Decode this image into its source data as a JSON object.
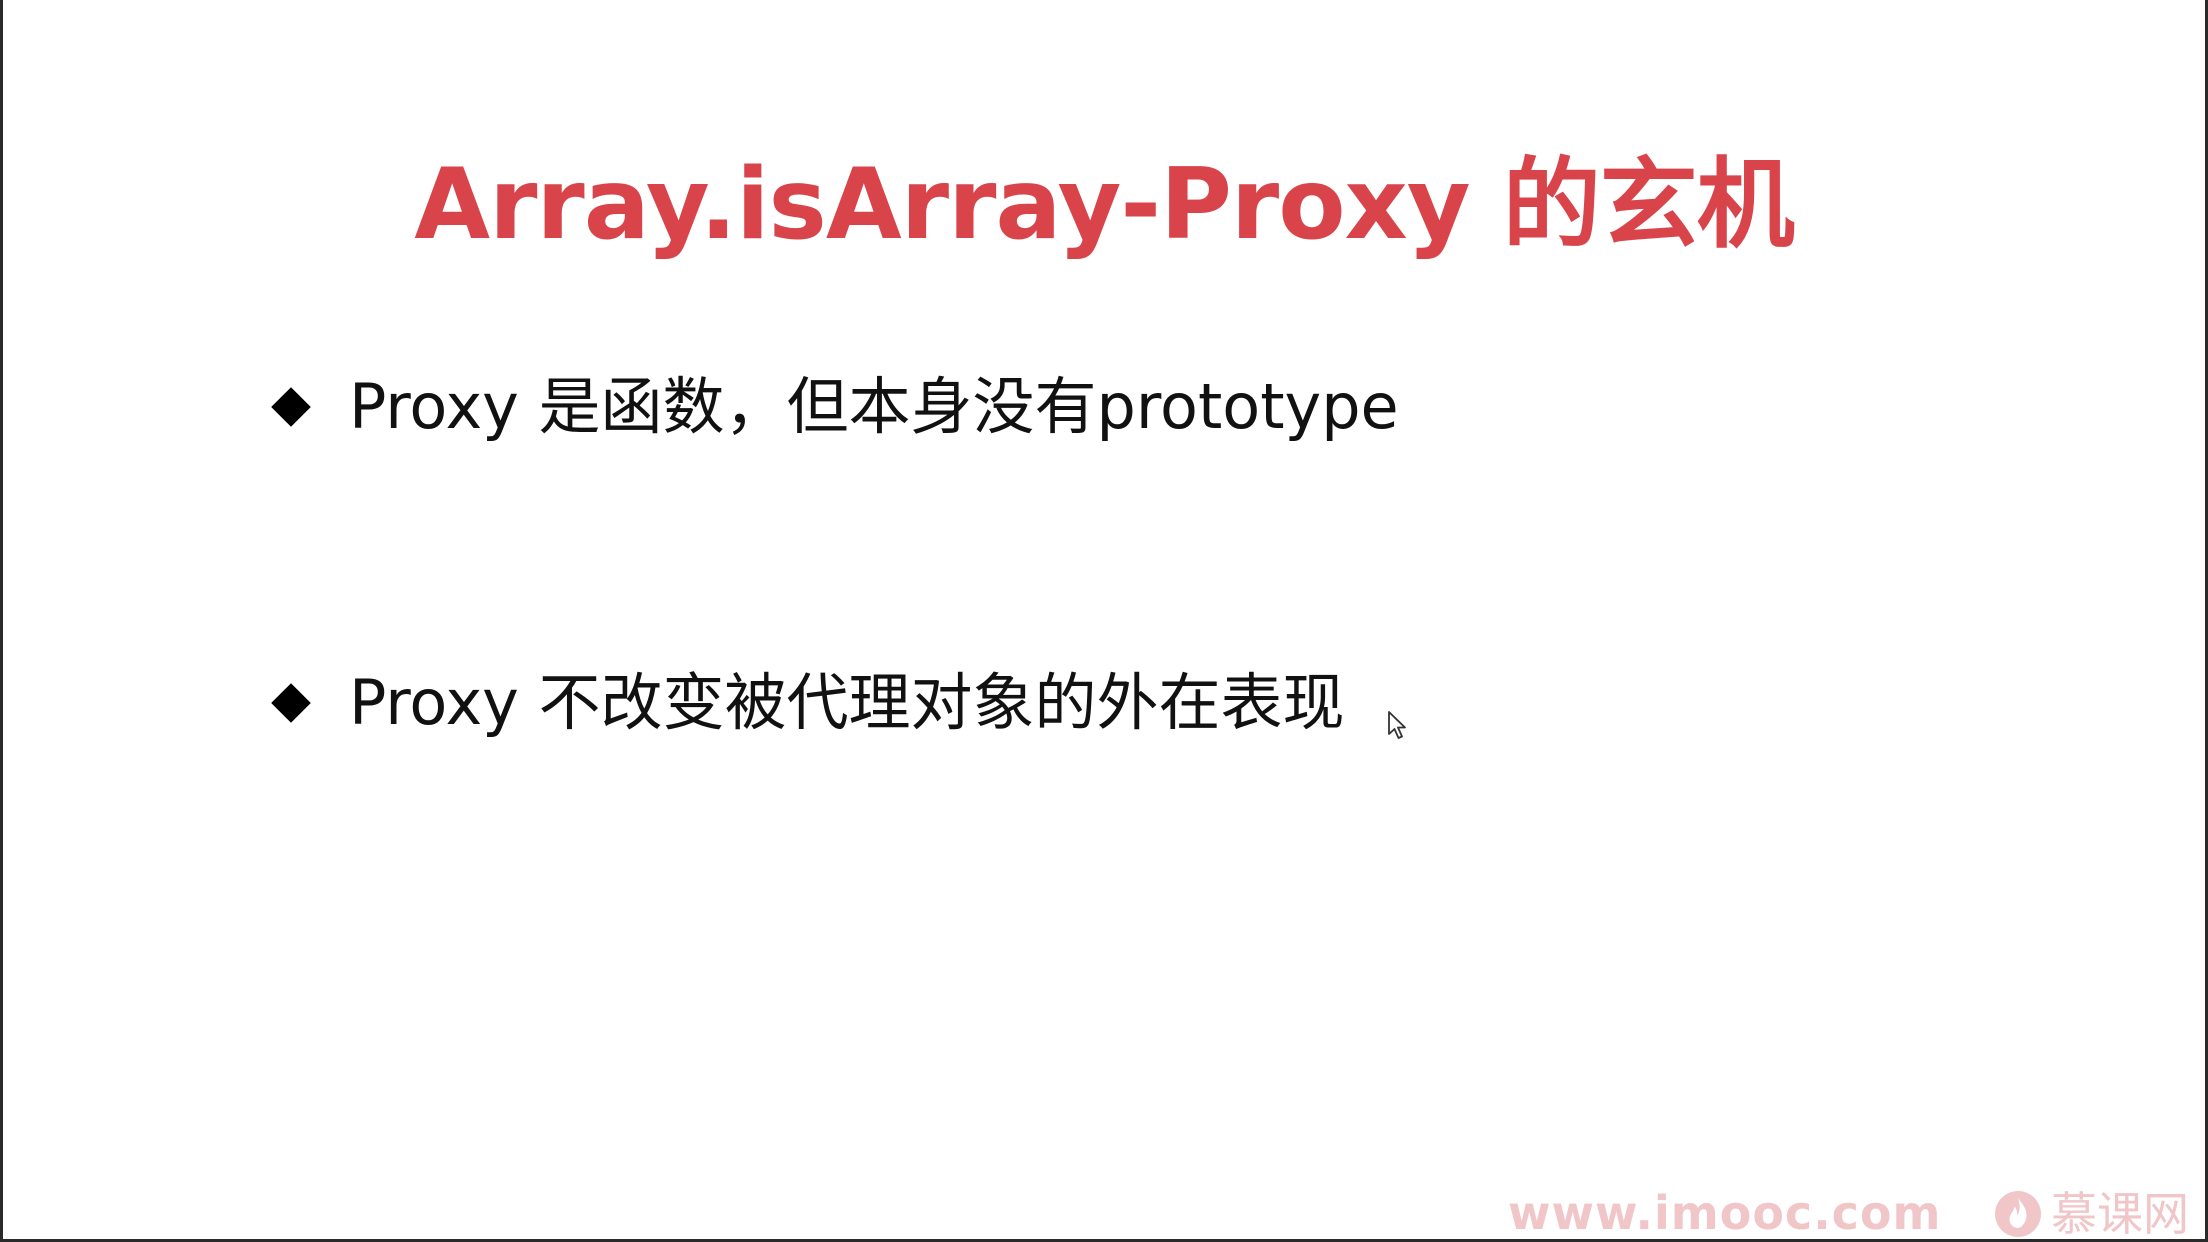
{
  "slide": {
    "title": "Array.isArray-Proxy 的玄机",
    "bullets": [
      {
        "text": "Proxy 是函数，但本身没有prototype"
      },
      {
        "text": "Proxy 不改变被代理对象的外在表现"
      }
    ]
  },
  "watermark": {
    "url": "www.imooc.com",
    "brand_name": "慕课网",
    "logo_icon": "imooc-flame-logo-icon",
    "color": "#f0c6c8"
  },
  "colors": {
    "title": "#d9444b",
    "text": "#111111",
    "bullet_marker": "#000000",
    "background": "#ffffff"
  },
  "cursor": {
    "icon": "mouse-pointer-icon"
  }
}
